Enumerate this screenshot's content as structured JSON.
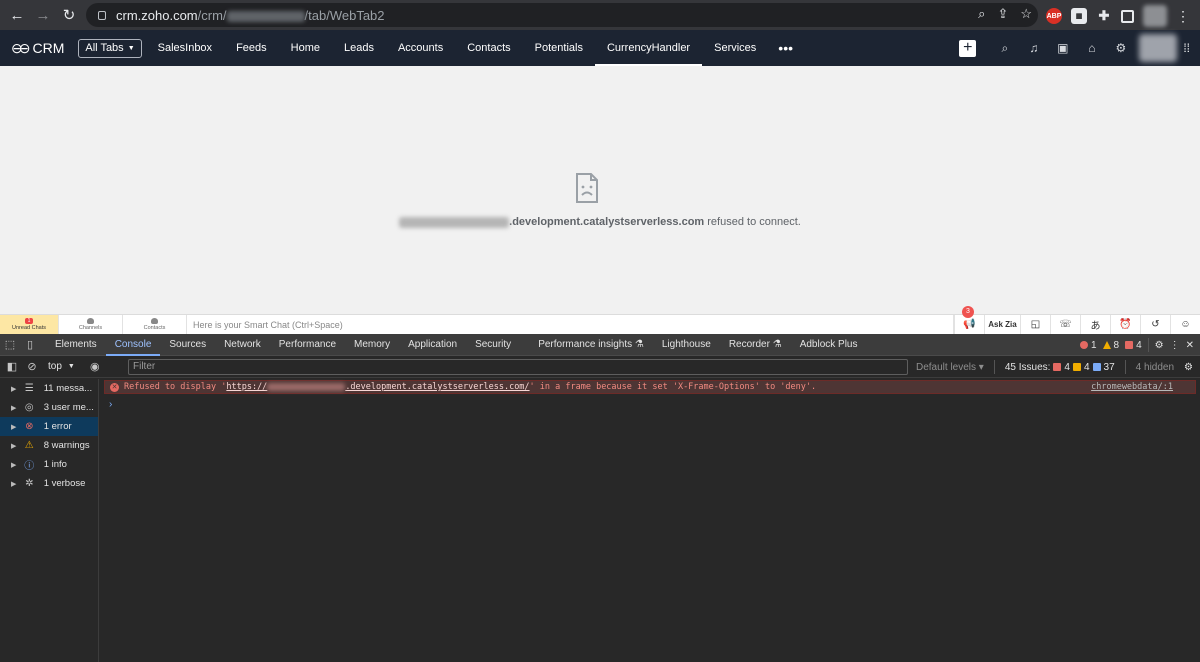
{
  "browser": {
    "url_host": "crm.zoho.com",
    "url_path_prefix": "/crm/",
    "url_path_suffix": "/tab/WebTab2"
  },
  "zoho": {
    "app_name": "CRM",
    "all_tabs_label": "All Tabs",
    "tabs": [
      "SalesInbox",
      "Feeds",
      "Home",
      "Leads",
      "Accounts",
      "Contacts",
      "Potentials",
      "CurrencyHandler",
      "Services"
    ],
    "active_tab": "CurrencyHandler",
    "more_label": "•••"
  },
  "page": {
    "refused_host_visible": ".development.catalystserverless.com",
    "refused_message": "refused to connect."
  },
  "bottom_bar": {
    "unread_chats_label": "Unread Chats",
    "unread_badge": "1",
    "channels_label": "Channels",
    "contacts_label": "Contacts",
    "smart_chat_placeholder": "Here is your Smart Chat (Ctrl+Space)",
    "announcement_badge": "3",
    "ask_zia_label": "Ask Zia"
  },
  "devtools": {
    "tabs": [
      "Elements",
      "Console",
      "Sources",
      "Network",
      "Performance",
      "Memory",
      "Application",
      "Security",
      "Performance insights ⚗",
      "Lighthouse",
      "Recorder ⚗",
      "Adblock Plus"
    ],
    "active_tab": "Console",
    "error_count": "1",
    "warning_count": "8",
    "issue_count": "4",
    "context": "top",
    "filter_placeholder": "Filter",
    "default_levels": "Default levels ▾",
    "issues_label": "45 Issues:",
    "issues_red": "4",
    "issues_yellow": "4",
    "issues_blue": "37",
    "hidden_label": "4 hidden",
    "sidebar": [
      {
        "label": "11 messa...",
        "icon": "list-icon"
      },
      {
        "label": "3 user me...",
        "icon": "user-icon"
      },
      {
        "label": "1 error",
        "icon": "error-icon"
      },
      {
        "label": "8 warnings",
        "icon": "warning-icon"
      },
      {
        "label": "1 info",
        "icon": "info-icon"
      },
      {
        "label": "1 verbose",
        "icon": "bug-icon"
      }
    ],
    "console_error": {
      "prefix": "Refused to display '",
      "link_start": "https://",
      "link_end": ".development.catalystserverless.com/",
      "suffix": "' in a frame because it set 'X-Frame-Options' to 'deny'.",
      "source": "chromewebdata/:1"
    },
    "prompt": "›"
  }
}
